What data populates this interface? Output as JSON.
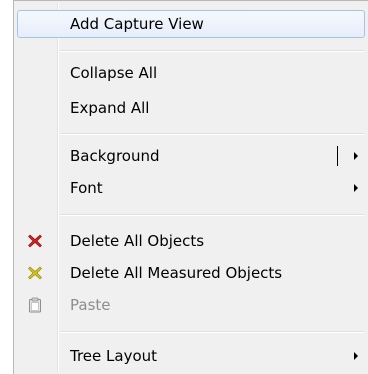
{
  "menu": {
    "items": [
      {
        "label": "Add Capture View"
      },
      {
        "label": "Collapse All"
      },
      {
        "label": "Expand All"
      },
      {
        "label": "Background"
      },
      {
        "label": "Font"
      },
      {
        "label": "Delete All Objects",
        "icon": "red-x-icon"
      },
      {
        "label": "Delete All Measured Objects",
        "icon": "yellow-x-icon"
      },
      {
        "label": "Paste",
        "icon": "clipboard-icon"
      },
      {
        "label": "Tree Layout"
      }
    ]
  },
  "colors": {
    "highlight_border": "#a8c3e9",
    "delete_icon": "#cc2222",
    "delete_measured_icon": "#d4c21a",
    "disabled_text": "#8d8d8d"
  }
}
